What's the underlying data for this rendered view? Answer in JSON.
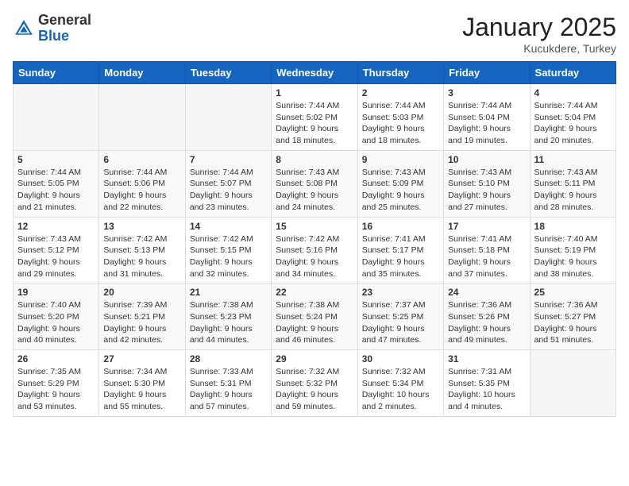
{
  "header": {
    "logo_general": "General",
    "logo_blue": "Blue",
    "month": "January 2025",
    "location": "Kucukdere, Turkey"
  },
  "weekdays": [
    "Sunday",
    "Monday",
    "Tuesday",
    "Wednesday",
    "Thursday",
    "Friday",
    "Saturday"
  ],
  "weeks": [
    [
      {
        "day": "",
        "content": ""
      },
      {
        "day": "",
        "content": ""
      },
      {
        "day": "",
        "content": ""
      },
      {
        "day": "1",
        "content": "Sunrise: 7:44 AM\nSunset: 5:02 PM\nDaylight: 9 hours\nand 18 minutes."
      },
      {
        "day": "2",
        "content": "Sunrise: 7:44 AM\nSunset: 5:03 PM\nDaylight: 9 hours\nand 18 minutes."
      },
      {
        "day": "3",
        "content": "Sunrise: 7:44 AM\nSunset: 5:04 PM\nDaylight: 9 hours\nand 19 minutes."
      },
      {
        "day": "4",
        "content": "Sunrise: 7:44 AM\nSunset: 5:04 PM\nDaylight: 9 hours\nand 20 minutes."
      }
    ],
    [
      {
        "day": "5",
        "content": "Sunrise: 7:44 AM\nSunset: 5:05 PM\nDaylight: 9 hours\nand 21 minutes."
      },
      {
        "day": "6",
        "content": "Sunrise: 7:44 AM\nSunset: 5:06 PM\nDaylight: 9 hours\nand 22 minutes."
      },
      {
        "day": "7",
        "content": "Sunrise: 7:44 AM\nSunset: 5:07 PM\nDaylight: 9 hours\nand 23 minutes."
      },
      {
        "day": "8",
        "content": "Sunrise: 7:43 AM\nSunset: 5:08 PM\nDaylight: 9 hours\nand 24 minutes."
      },
      {
        "day": "9",
        "content": "Sunrise: 7:43 AM\nSunset: 5:09 PM\nDaylight: 9 hours\nand 25 minutes."
      },
      {
        "day": "10",
        "content": "Sunrise: 7:43 AM\nSunset: 5:10 PM\nDaylight: 9 hours\nand 27 minutes."
      },
      {
        "day": "11",
        "content": "Sunrise: 7:43 AM\nSunset: 5:11 PM\nDaylight: 9 hours\nand 28 minutes."
      }
    ],
    [
      {
        "day": "12",
        "content": "Sunrise: 7:43 AM\nSunset: 5:12 PM\nDaylight: 9 hours\nand 29 minutes."
      },
      {
        "day": "13",
        "content": "Sunrise: 7:42 AM\nSunset: 5:13 PM\nDaylight: 9 hours\nand 31 minutes."
      },
      {
        "day": "14",
        "content": "Sunrise: 7:42 AM\nSunset: 5:15 PM\nDaylight: 9 hours\nand 32 minutes."
      },
      {
        "day": "15",
        "content": "Sunrise: 7:42 AM\nSunset: 5:16 PM\nDaylight: 9 hours\nand 34 minutes."
      },
      {
        "day": "16",
        "content": "Sunrise: 7:41 AM\nSunset: 5:17 PM\nDaylight: 9 hours\nand 35 minutes."
      },
      {
        "day": "17",
        "content": "Sunrise: 7:41 AM\nSunset: 5:18 PM\nDaylight: 9 hours\nand 37 minutes."
      },
      {
        "day": "18",
        "content": "Sunrise: 7:40 AM\nSunset: 5:19 PM\nDaylight: 9 hours\nand 38 minutes."
      }
    ],
    [
      {
        "day": "19",
        "content": "Sunrise: 7:40 AM\nSunset: 5:20 PM\nDaylight: 9 hours\nand 40 minutes."
      },
      {
        "day": "20",
        "content": "Sunrise: 7:39 AM\nSunset: 5:21 PM\nDaylight: 9 hours\nand 42 minutes."
      },
      {
        "day": "21",
        "content": "Sunrise: 7:38 AM\nSunset: 5:23 PM\nDaylight: 9 hours\nand 44 minutes."
      },
      {
        "day": "22",
        "content": "Sunrise: 7:38 AM\nSunset: 5:24 PM\nDaylight: 9 hours\nand 46 minutes."
      },
      {
        "day": "23",
        "content": "Sunrise: 7:37 AM\nSunset: 5:25 PM\nDaylight: 9 hours\nand 47 minutes."
      },
      {
        "day": "24",
        "content": "Sunrise: 7:36 AM\nSunset: 5:26 PM\nDaylight: 9 hours\nand 49 minutes."
      },
      {
        "day": "25",
        "content": "Sunrise: 7:36 AM\nSunset: 5:27 PM\nDaylight: 9 hours\nand 51 minutes."
      }
    ],
    [
      {
        "day": "26",
        "content": "Sunrise: 7:35 AM\nSunset: 5:29 PM\nDaylight: 9 hours\nand 53 minutes."
      },
      {
        "day": "27",
        "content": "Sunrise: 7:34 AM\nSunset: 5:30 PM\nDaylight: 9 hours\nand 55 minutes."
      },
      {
        "day": "28",
        "content": "Sunrise: 7:33 AM\nSunset: 5:31 PM\nDaylight: 9 hours\nand 57 minutes."
      },
      {
        "day": "29",
        "content": "Sunrise: 7:32 AM\nSunset: 5:32 PM\nDaylight: 9 hours\nand 59 minutes."
      },
      {
        "day": "30",
        "content": "Sunrise: 7:32 AM\nSunset: 5:34 PM\nDaylight: 10 hours\nand 2 minutes."
      },
      {
        "day": "31",
        "content": "Sunrise: 7:31 AM\nSunset: 5:35 PM\nDaylight: 10 hours\nand 4 minutes."
      },
      {
        "day": "",
        "content": ""
      }
    ]
  ]
}
